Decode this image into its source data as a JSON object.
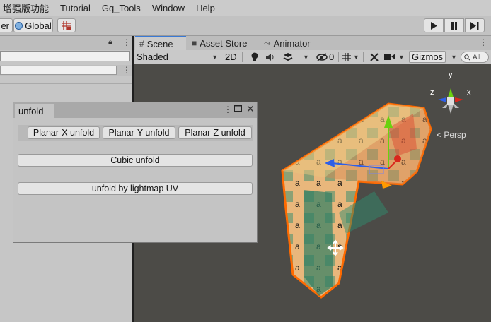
{
  "menubar": {
    "items": [
      "增强版功能",
      "Tutorial",
      "Gq_Tools",
      "Window",
      "Help"
    ]
  },
  "toolbar": {
    "pivot_label": "er",
    "global_label": "Global",
    "grid_icon": "grid-snap-icon",
    "play_icon": "play-icon",
    "pause_icon": "pause-icon",
    "step_icon": "step-icon"
  },
  "tabs": {
    "scene": "Scene",
    "asset_store": "Asset Store",
    "animator": "Animator"
  },
  "scene_toolbar": {
    "shading_mode": "Shaded",
    "mode_2d": "2D",
    "hidden_count": "0",
    "gizmos": "Gizmos",
    "search_placeholder": "All"
  },
  "viewport": {
    "projection": "Persp",
    "axis_y": "y",
    "axis_x": "x",
    "axis_z": "z"
  },
  "unfold_window": {
    "title": "unfold",
    "buttons": {
      "planar_x": "Planar-X unfold",
      "planar_y": "Planar-Y unfold",
      "planar_z": "Planar-Z unfold",
      "cubic": "Cubic unfold",
      "lightmap": "unfold by lightmap UV"
    }
  },
  "colors": {
    "selection_outline": "#ff6a00",
    "accent_tab": "#3a79d4",
    "viewport_bg": "#4c4b47",
    "axis_x": "#d9261c",
    "axis_y": "#6bd10e",
    "axis_z": "#2f5fe8"
  }
}
